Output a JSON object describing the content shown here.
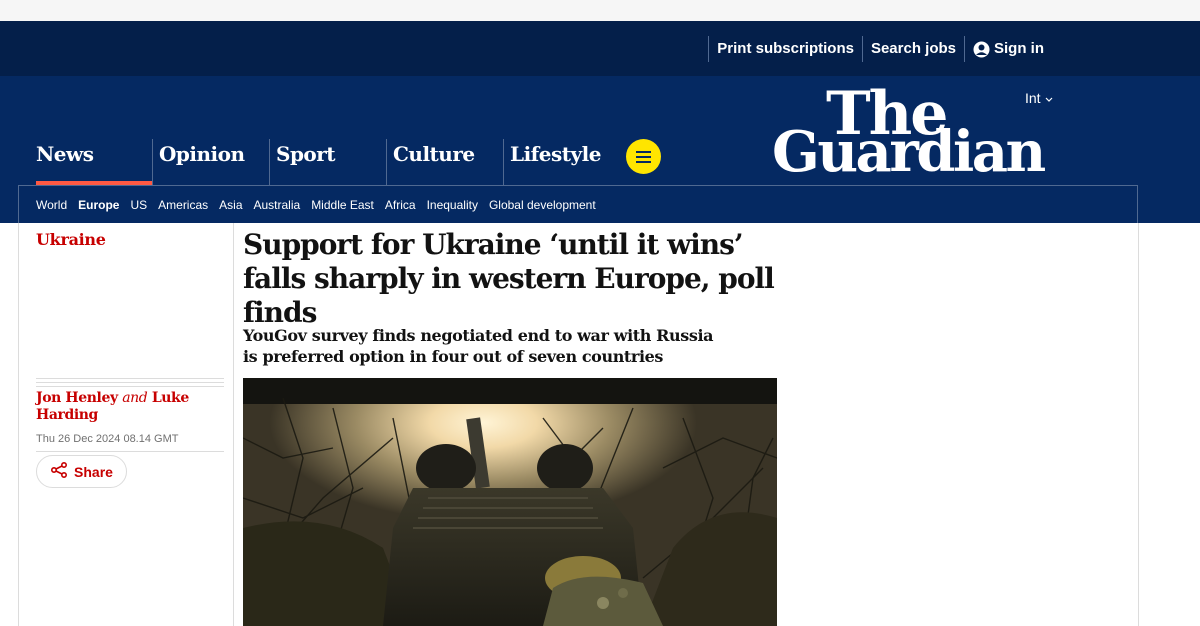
{
  "utility": {
    "print_subscriptions": "Print subscriptions",
    "search_jobs": "Search jobs",
    "sign_in": "Sign in"
  },
  "edition": "Int",
  "logo": {
    "line1": "The",
    "line2": "Guardian"
  },
  "pillars": [
    {
      "label": "News",
      "active": true
    },
    {
      "label": "Opinion",
      "active": false
    },
    {
      "label": "Sport",
      "active": false
    },
    {
      "label": "Culture",
      "active": false
    },
    {
      "label": "Lifestyle",
      "active": false
    }
  ],
  "subnav": [
    "World",
    "Europe",
    "US",
    "Americas",
    "Asia",
    "Australia",
    "Middle East",
    "Africa",
    "Inequality",
    "Global development"
  ],
  "subnav_active": "Europe",
  "article": {
    "kicker": "Ukraine",
    "headline": "Support for Ukraine ‘until it wins’ falls sharply in western Europe, poll finds",
    "standfirst": "YouGov survey finds negotiated end to war with Russia is preferred option in four out of seven countries",
    "byline": {
      "author1": "Jon Henley",
      "and": "and",
      "author2": "Luke Harding"
    },
    "date": "Thu 26 Dec 2024 08.14 GMT",
    "share_label": "Share"
  },
  "colors": {
    "brand_dark": "#041f4a",
    "brand": "#052962",
    "news_red": "#c70000",
    "accent_underline": "#ff5943",
    "menu_yellow": "#ffe500"
  }
}
